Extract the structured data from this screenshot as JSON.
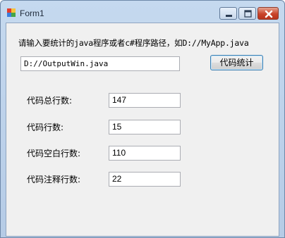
{
  "window": {
    "title": "Form1"
  },
  "form": {
    "prompt": "请输入要统计的java程序或者c#程序路径，如D://MyApp.java",
    "path_value": "D://OutputWin.java",
    "count_button_label": "代码统计"
  },
  "stats": [
    {
      "label": "代码总行数:",
      "value": "147"
    },
    {
      "label": "代码行数:",
      "value": "15"
    },
    {
      "label": "代码空白行数:",
      "value": "110"
    },
    {
      "label": "代码注释行数:",
      "value": "22"
    }
  ],
  "icons": {
    "app": "form-app-icon",
    "minimize": "minimize-icon",
    "maximize": "maximize-icon",
    "close": "close-icon"
  }
}
